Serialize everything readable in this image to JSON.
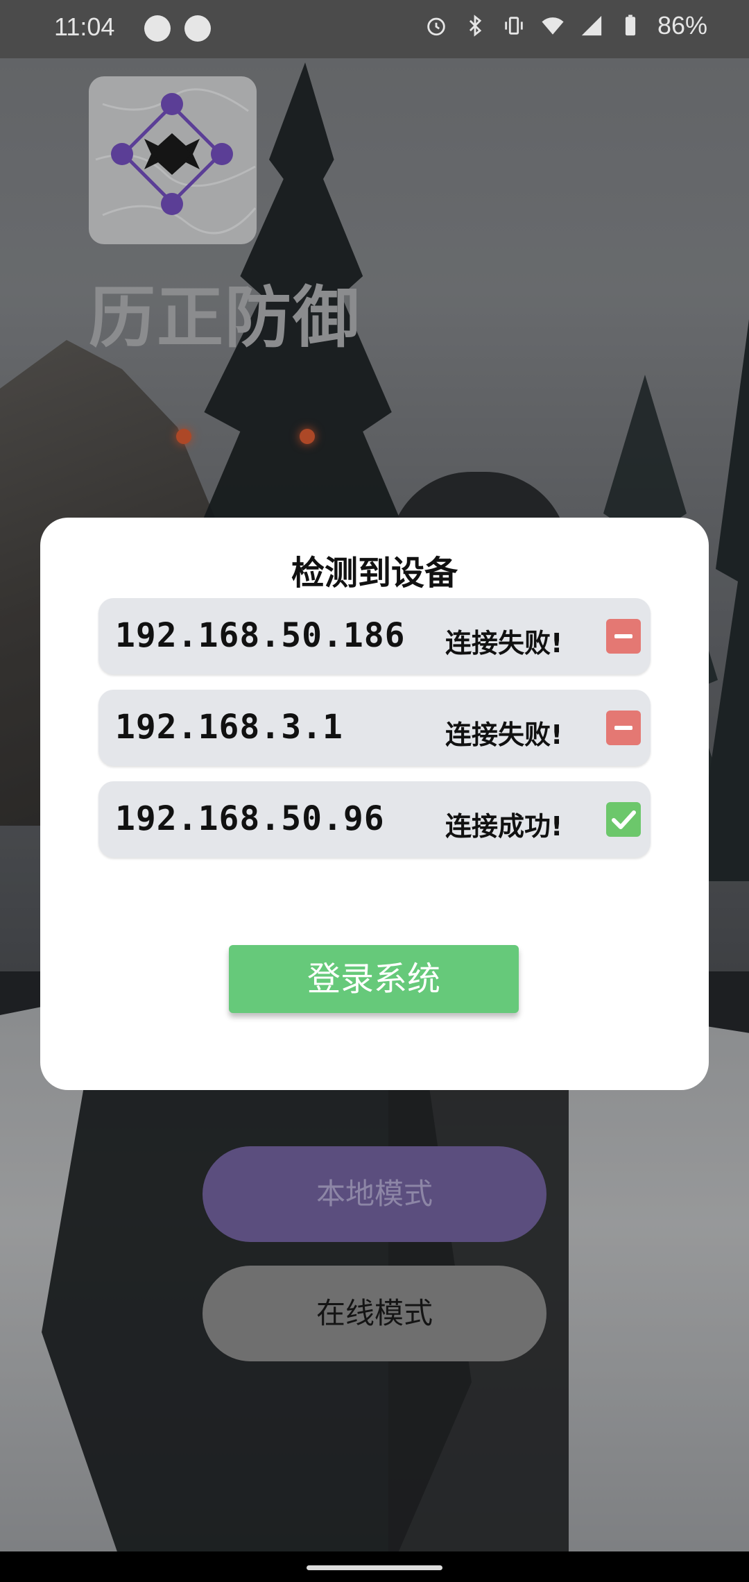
{
  "status_bar": {
    "time": "11:04",
    "battery_percent": "86%"
  },
  "brand": {
    "name": "历正防御"
  },
  "dialog": {
    "title": "检测到设备",
    "devices": [
      {
        "ip": "192.168.50.186",
        "status": "连接失败!",
        "state": "fail"
      },
      {
        "ip": "192.168.3.1",
        "status": "连接失败!",
        "state": "fail"
      },
      {
        "ip": "192.168.50.96",
        "status": "连接成功!",
        "state": "ok"
      }
    ],
    "login_label": "登录系统"
  },
  "modes": {
    "local_label": "本地模式",
    "online_label": "在线模式"
  },
  "colors": {
    "fail": "#e47873",
    "ok": "#6cc76b",
    "login_button": "#66c97a",
    "local_mode": "#5b4e7e"
  }
}
